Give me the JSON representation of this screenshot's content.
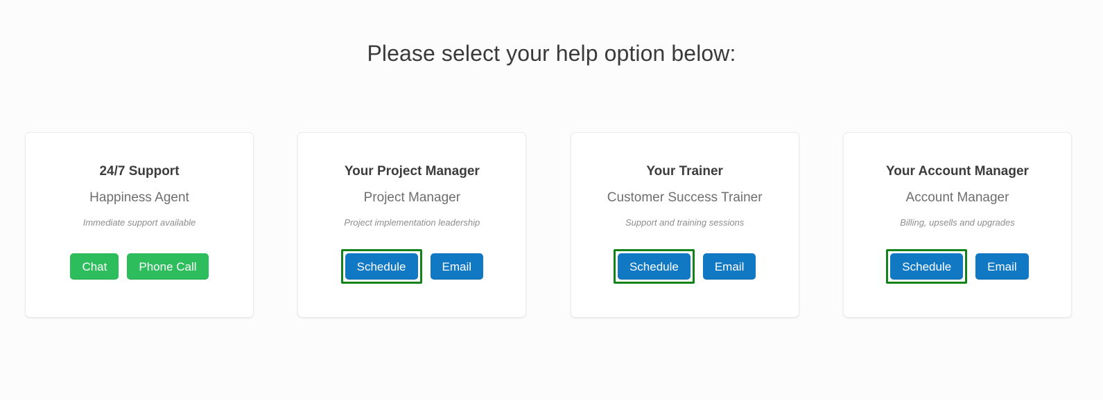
{
  "page": {
    "heading": "Please select your help option below:",
    "background_color": "#fcfcfc"
  },
  "colors": {
    "heading_text": "#3a3a3a",
    "card_background": "#ffffff",
    "card_border": "#ececec",
    "title_text": "#3c3c3c",
    "role_text": "#6e6e6e",
    "note_text": "#8d8d8d",
    "button_green": "#2ebd5d",
    "button_blue": "#1179c4",
    "highlight_green": "#12821a"
  },
  "cards": [
    {
      "title": "24/7 Support",
      "role": "Happiness Agent",
      "note": "Immediate support available",
      "buttons": [
        {
          "label": "Chat",
          "style": "green",
          "highlighted": false
        },
        {
          "label": "Phone Call",
          "style": "green",
          "highlighted": false
        }
      ]
    },
    {
      "title": "Your Project Manager",
      "role": "Project Manager",
      "note": "Project implementation leadership",
      "buttons": [
        {
          "label": "Schedule",
          "style": "blue",
          "highlighted": true
        },
        {
          "label": "Email",
          "style": "blue",
          "highlighted": false
        }
      ]
    },
    {
      "title": "Your Trainer",
      "role": "Customer Success Trainer",
      "note": "Support and training sessions",
      "buttons": [
        {
          "label": "Schedule",
          "style": "blue",
          "highlighted": true
        },
        {
          "label": "Email",
          "style": "blue",
          "highlighted": false
        }
      ]
    },
    {
      "title": "Your Account Manager",
      "role": "Account Manager",
      "note": "Billing, upsells and upgrades",
      "buttons": [
        {
          "label": "Schedule",
          "style": "blue",
          "highlighted": true
        },
        {
          "label": "Email",
          "style": "blue",
          "highlighted": false
        }
      ]
    }
  ]
}
